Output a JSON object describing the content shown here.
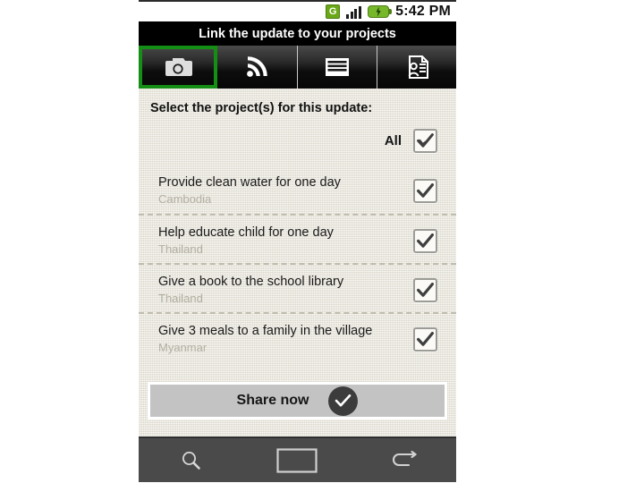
{
  "status_bar": {
    "network_icon": "gprs-g-icon",
    "network_label": "G",
    "signal_icon": "signal-bars-icon",
    "battery_icon": "battery-charging-icon",
    "time": "5:42 PM"
  },
  "title_bar": {
    "title": "Link the update to your projects"
  },
  "tabs": [
    {
      "name": "tab-camera",
      "icon": "camera-icon",
      "selected": true
    },
    {
      "name": "tab-rss",
      "icon": "rss-waves-icon",
      "selected": false
    },
    {
      "name": "tab-list",
      "icon": "list-lines-icon",
      "selected": false
    },
    {
      "name": "tab-contact",
      "icon": "contact-document-icon",
      "selected": false
    }
  ],
  "content": {
    "prompt": "Select the project(s) for this update:",
    "all_row": {
      "label": "All",
      "checked": true,
      "check_icon": "checkmark-icon"
    },
    "projects": [
      {
        "title": "Provide clean water for one day",
        "country": "Cambodia",
        "checked": true
      },
      {
        "title": "Help educate child for one day",
        "country": "Thailand",
        "checked": true
      },
      {
        "title": "Give a book to the school library",
        "country": "Thailand",
        "checked": true
      },
      {
        "title": "Give 3 meals to a family in the village",
        "country": "Myanmar",
        "checked": true
      }
    ],
    "share_button": {
      "label": "Share now",
      "icon": "circle-check-icon"
    }
  },
  "bottom_nav": [
    {
      "name": "nav-search",
      "icon": "search-icon"
    },
    {
      "name": "nav-home",
      "icon": "home-rectangle-icon"
    },
    {
      "name": "nav-back",
      "icon": "back-arrow-icon"
    }
  ],
  "colors": {
    "selected_tab_outline": "#158e15",
    "title_bar_bg": "#000000",
    "content_bg": "#e9e5d8",
    "share_button_bg": "#c3c3c3",
    "bottom_nav_bg": "#4a4a4a"
  }
}
